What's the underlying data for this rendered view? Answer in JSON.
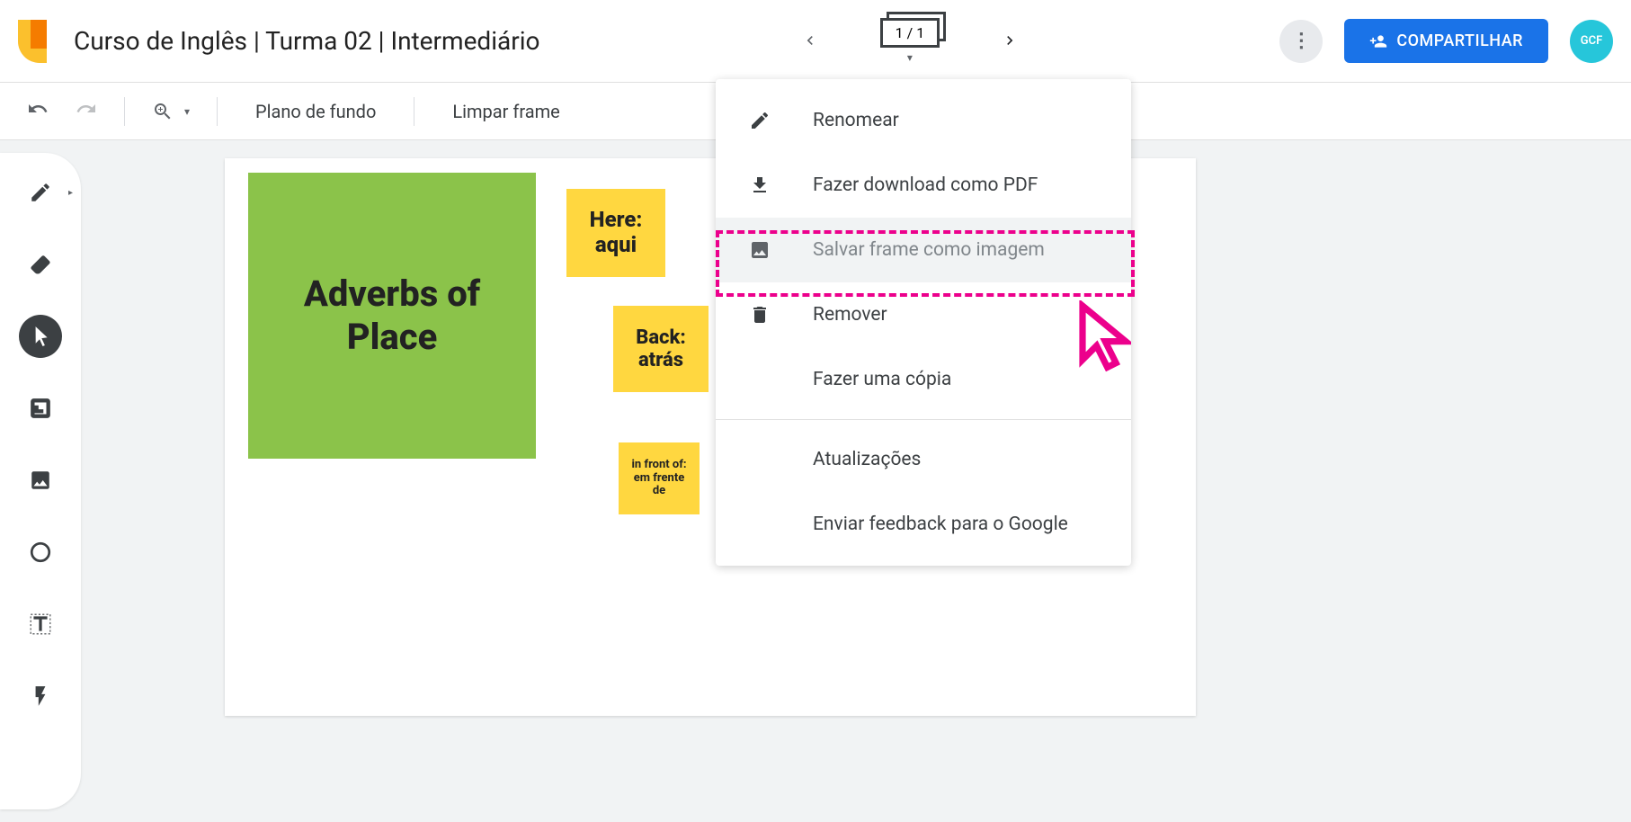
{
  "header": {
    "title": "Curso de Inglês | Turma 02 | Intermediário",
    "frame_counter": "1 / 1",
    "share_label": "COMPARTILHAR",
    "avatar_text": "GCF"
  },
  "subtoolbar": {
    "background_label": "Plano de fundo",
    "clear_frame_label": "Limpar frame"
  },
  "canvas": {
    "big_note": "Adverbs of Place",
    "note1": "Here: aqui",
    "note2": "Back: atrás",
    "note3": "in front of: em frente de"
  },
  "menu": {
    "items": [
      {
        "icon": "edit",
        "label": "Renomear"
      },
      {
        "icon": "download",
        "label": "Fazer download como PDF"
      },
      {
        "icon": "image",
        "label": "Salvar frame como imagem",
        "highlighted": true
      },
      {
        "icon": "trash",
        "label": "Remover"
      },
      {
        "icon": "",
        "label": "Fazer uma cópia"
      },
      {
        "icon": "",
        "label": "Atualizações",
        "separator_before": true
      },
      {
        "icon": "",
        "label": "Enviar feedback para o Google"
      }
    ]
  }
}
